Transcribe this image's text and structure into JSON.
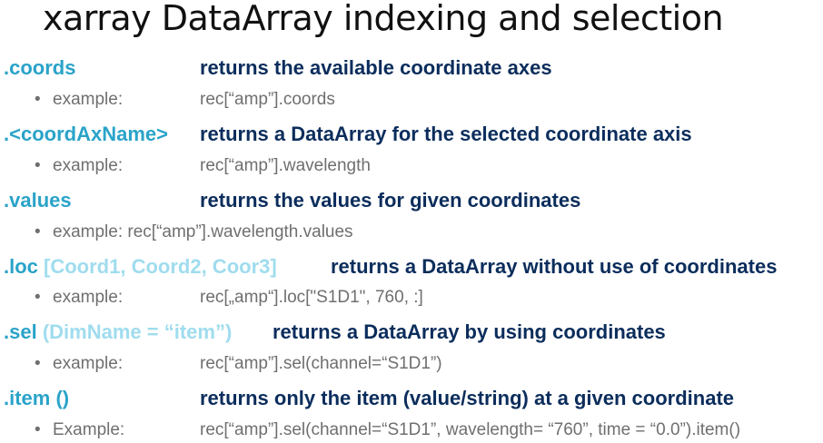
{
  "slide": {
    "title": "xarray DataArray indexing and selection"
  },
  "items": [
    {
      "keyword": ".coords",
      "args": "",
      "description": "returns the available coordinate axes",
      "example_label": "example:",
      "example_code": "rec[“amp”].coords"
    },
    {
      "keyword": ".<coordAxName>",
      "args": "",
      "description": "returns a DataArray for the selected coordinate axis",
      "example_label": "example:",
      "example_code": "rec[“amp”].wavelength"
    },
    {
      "keyword": ".values",
      "args": "",
      "description": "returns the values for given coordinates",
      "example_label": "example:",
      "example_code": "rec[“amp”].wavelength.values"
    },
    {
      "keyword": ".loc",
      "args": "[Coord1, Coord2, Coor3]",
      "description": "returns a DataArray without use of coordinates",
      "example_label": "example:",
      "example_code": "rec[„amp“].loc[\"S1D1\", 760, :]"
    },
    {
      "keyword": ".sel",
      "args": "(DimName = “item”)",
      "description": "returns a DataArray by using coordinates",
      "example_label": "example:",
      "example_code": "rec[“amp”].sel(channel=“S1D1”)"
    },
    {
      "keyword": ".item",
      "args": "()",
      "description": "returns only the item (value/string) at a given coordinate",
      "example_label": "Example:",
      "example_code": "rec[“amp”].sel(channel=“S1D1”, wavelength= “760”, time = “0.0”).item()"
    }
  ]
}
